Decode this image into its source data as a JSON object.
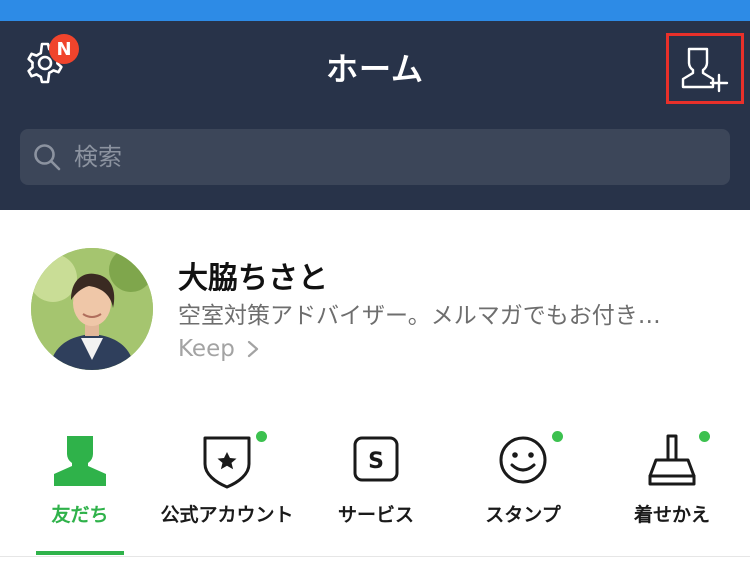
{
  "header": {
    "title": "ホーム",
    "settings_badge": "N",
    "search": {
      "placeholder": "検索",
      "value": ""
    }
  },
  "profile": {
    "name": "大脇ちさと",
    "status_message": "空室対策アドバイザー。メルマガでもお付き…",
    "keep_label": "Keep"
  },
  "tabs": [
    {
      "label": "友だち",
      "icon": "friends-icon",
      "active": true,
      "new_dot": false
    },
    {
      "label": "公式アカウント",
      "icon": "official-account-icon",
      "active": false,
      "new_dot": true
    },
    {
      "label": "サービス",
      "icon": "services-icon",
      "active": false,
      "new_dot": false
    },
    {
      "label": "スタンプ",
      "icon": "smiley-icon",
      "active": false,
      "new_dot": true
    },
    {
      "label": "着せかえ",
      "icon": "paint-brush-icon",
      "active": false,
      "new_dot": true
    }
  ],
  "colors": {
    "header_bg": "#283349",
    "accent_green": "#2fb24a",
    "badge_red": "#f0442c",
    "highlight_red": "#e8302a",
    "new_dot_green": "#3cc14f"
  }
}
